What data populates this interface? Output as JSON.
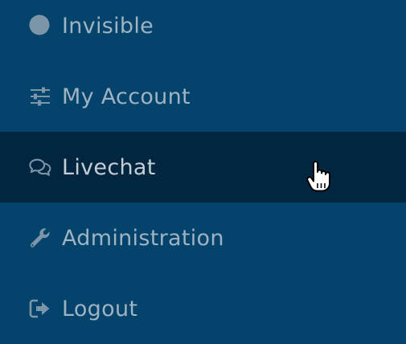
{
  "menu": {
    "items": [
      {
        "label": "Invisible",
        "icon": "status-circle-icon"
      },
      {
        "label": "My Account",
        "icon": "sliders-icon"
      },
      {
        "label": "Livechat",
        "icon": "chat-bubbles-icon",
        "active": true
      },
      {
        "label": "Administration",
        "icon": "wrench-icon"
      },
      {
        "label": "Logout",
        "icon": "sign-out-icon"
      }
    ]
  },
  "colors": {
    "background": "#04436b",
    "active_background": "#02263f",
    "text": "#9fb3c3",
    "icon": "#7d95a8"
  }
}
